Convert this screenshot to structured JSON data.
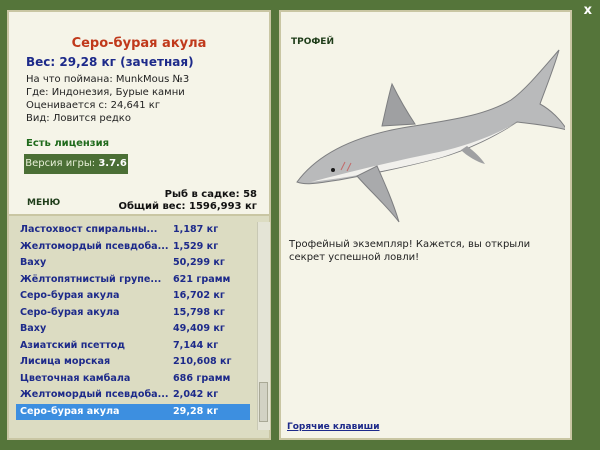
{
  "close_label": "x",
  "fish": {
    "title": "Серо-бурая акула",
    "weight_line": "Вес: 29,28 кг (зачетная)",
    "caught_on": "На что поймана: MunkMous №3",
    "where": "Где: Индонезия, Бурые камни",
    "valued_at": "Оценивается с: 24,641 кг",
    "kind": "Вид: Ловится редко"
  },
  "license": "Есть лицензия",
  "version": {
    "label": "Версия игры:",
    "value": "3.7.6"
  },
  "menu_label": "меню",
  "catch_stats": {
    "count_line": "Рыб в садке: 58",
    "total_line": "Общий вес: 1596,993 кг"
  },
  "catch_list": [
    {
      "name": "Ластохвост спиральны...",
      "weight": "1,187 кг"
    },
    {
      "name": "Желтомордый псевдоба...",
      "weight": "1,529 кг"
    },
    {
      "name": "Ваху",
      "weight": "50,299 кг"
    },
    {
      "name": "Жёлтопятнистый групе...",
      "weight": "621 грамм"
    },
    {
      "name": "Серо-бурая акула",
      "weight": "16,702 кг"
    },
    {
      "name": "Серо-бурая акула",
      "weight": "15,798 кг"
    },
    {
      "name": "Ваху",
      "weight": "49,409 кг"
    },
    {
      "name": "Азиатский псеттод",
      "weight": "7,144 кг"
    },
    {
      "name": "Лисица морская",
      "weight": "210,608 кг"
    },
    {
      "name": "Цветочная камбала",
      "weight": "686 грамм"
    },
    {
      "name": "Желтомордый псевдоба...",
      "weight": "2,042 кг"
    },
    {
      "name": "Серо-бурая акула",
      "weight": "29,28 кг",
      "selected": true
    }
  ],
  "trophy_label": "трофей",
  "description": "Трофейный экземпляр! Кажется, вы открыли секрет успешной ловли!",
  "hotkeys_label": "Горячие клавиши",
  "colors": {
    "frame": "#55753a",
    "selection": "#3d8fe0",
    "title": "#c0391b",
    "value_text": "#1d2a8a"
  }
}
